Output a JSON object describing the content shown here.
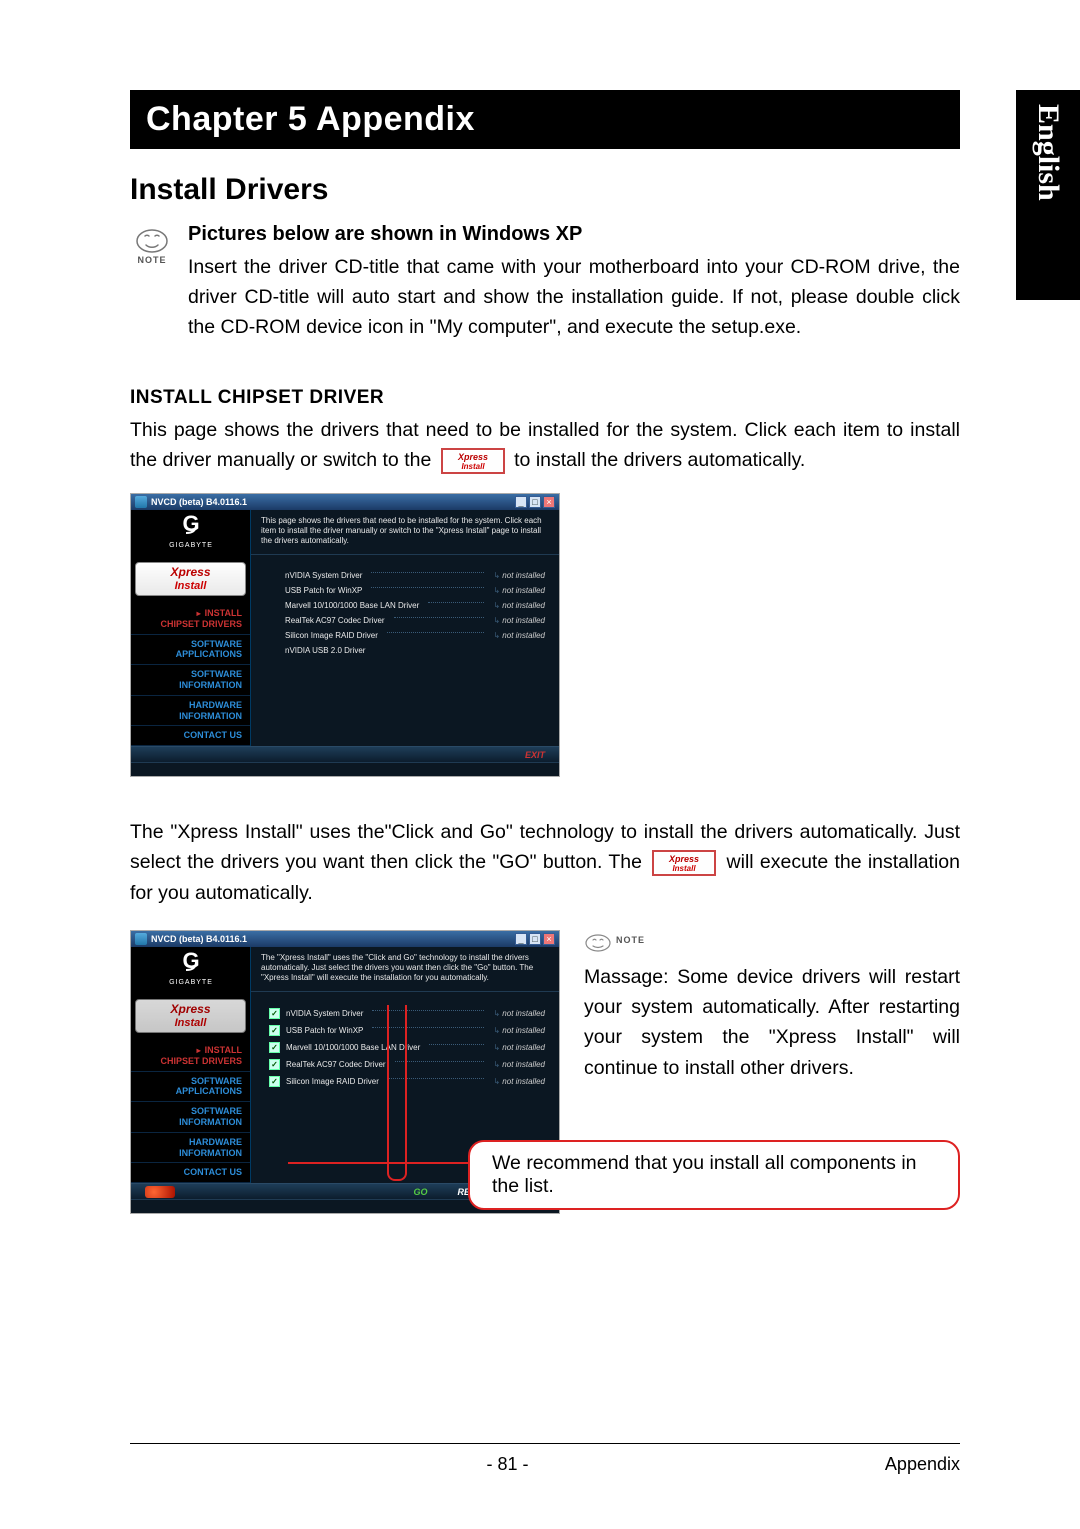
{
  "lang_tab": "English",
  "chapter_title": "Chapter 5  Appendix",
  "section_title": "Install Drivers",
  "note_label": "NOTE",
  "sub1_title": "Pictures below are shown in Windows XP",
  "sub1_body": "Insert the driver CD-title that came with your motherboard into your CD-ROM drive, the driver CD-title will auto start and show the installation guide. If not, please double click the CD-ROM device icon in \"My computer\", and execute the setup.exe.",
  "h3_title": "INSTALL CHIPSET DRIVER",
  "h3_body_a": "This page shows the drivers that need to be installed for the system. Click each item to install the driver manually or switch to the ",
  "h3_body_b": " to install the drivers automatically.",
  "xpress_name": "Xpress",
  "xpress_sub": "Install",
  "app": {
    "title": "NVCD (beta) B4.0116.1",
    "brand": "GIGABYTE",
    "nav": {
      "install_chipset": "INSTALL\nCHIPSET DRIVERS",
      "software_apps": "SOFTWARE\nAPPLICATIONS",
      "software_info": "SOFTWARE\nINFORMATION",
      "hardware_info": "HARDWARE\nINFORMATION",
      "contact": "CONTACT US"
    },
    "desc1": "This page shows the drivers that need to be installed for the system. Click each item to install the driver manually or switch to the \"Xpress Install\" page to install the drivers automatically.",
    "desc2": "The \"Xpress Install\" uses the \"Click and Go\" technology to install the drivers automatically. Just select the drivers you want then click the \"Go\" button. The \"Xpress Install\" will execute the installation for you automatically.",
    "drivers": [
      {
        "name": "nVIDIA System Driver",
        "status": "not installed"
      },
      {
        "name": "USB Patch for WinXP",
        "status": "not installed"
      },
      {
        "name": "Marvell 10/100/1000 Base LAN Driver",
        "status": "not installed"
      },
      {
        "name": "RealTek AC97 Codec Driver",
        "status": "not installed"
      },
      {
        "name": "Silicon Image RAID Driver",
        "status": "not installed"
      },
      {
        "name": "nVIDIA USB 2.0 Driver",
        "status": ""
      }
    ],
    "btn_exit": "EXIT",
    "btn_go": "GO",
    "btn_return": "RETURN"
  },
  "para2_a": "The \"Xpress Install\" uses the\"Click and Go\" technology to install the drivers automatically. Just select the drivers you want then click the \"GO\" button. The ",
  "para2_b": " will execute the installation for you automatically.",
  "right_note": "Massage: Some device drivers will restart your system automatically. After restarting your system the \"Xpress Install\" will continue to install other drivers.",
  "callout": "We recommend that you install all components in the list.",
  "footer_page": "- 81 -",
  "footer_section": "Appendix"
}
